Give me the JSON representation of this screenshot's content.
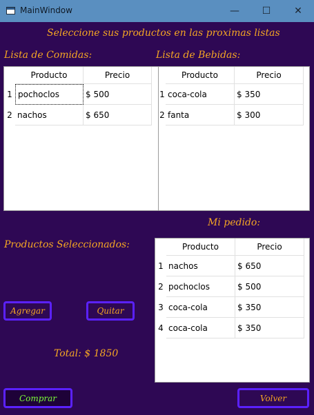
{
  "window": {
    "title": "MainWindow",
    "minimize": "—",
    "maximize": "☐",
    "close": "✕"
  },
  "header": "Seleccione sus productos en las proximas listas",
  "comidas": {
    "label": "Lista de Comidas:",
    "headers": [
      "Producto",
      "Precio"
    ],
    "rows": [
      {
        "n": "1",
        "producto": "pochoclos",
        "precio": "$ 500"
      },
      {
        "n": "2",
        "producto": "nachos",
        "precio": "$ 650"
      }
    ]
  },
  "bebidas": {
    "label": "Lista de Bebidas:",
    "headers": [
      "Producto",
      "Precio"
    ],
    "rows": [
      {
        "n": "1",
        "producto": "coca-cola",
        "precio": "$ 350"
      },
      {
        "n": "2",
        "producto": "fanta",
        "precio": "$ 300"
      }
    ]
  },
  "pedido": {
    "label": "Mi pedido:",
    "headers": [
      "Producto",
      "Precio"
    ],
    "rows": [
      {
        "n": "1",
        "producto": "nachos",
        "precio": "$ 650"
      },
      {
        "n": "2",
        "producto": "pochoclos",
        "precio": "$ 500"
      },
      {
        "n": "3",
        "producto": "coca-cola",
        "precio": "$ 350"
      },
      {
        "n": "4",
        "producto": "coca-cola",
        "precio": "$ 350"
      }
    ]
  },
  "seleccionados_label": "Productos Seleccionados:",
  "buttons": {
    "agregar": "Agregar",
    "quitar": "Quitar",
    "comprar": "Comprar",
    "volver": "Volver"
  },
  "total": "Total: $ 1850",
  "colors": {
    "background": "#2e0854",
    "accent_text": "#f5a623",
    "button_border": "#5b21ff",
    "comprar_text": "#7dff3a",
    "titlebar": "#5a8fc0"
  }
}
